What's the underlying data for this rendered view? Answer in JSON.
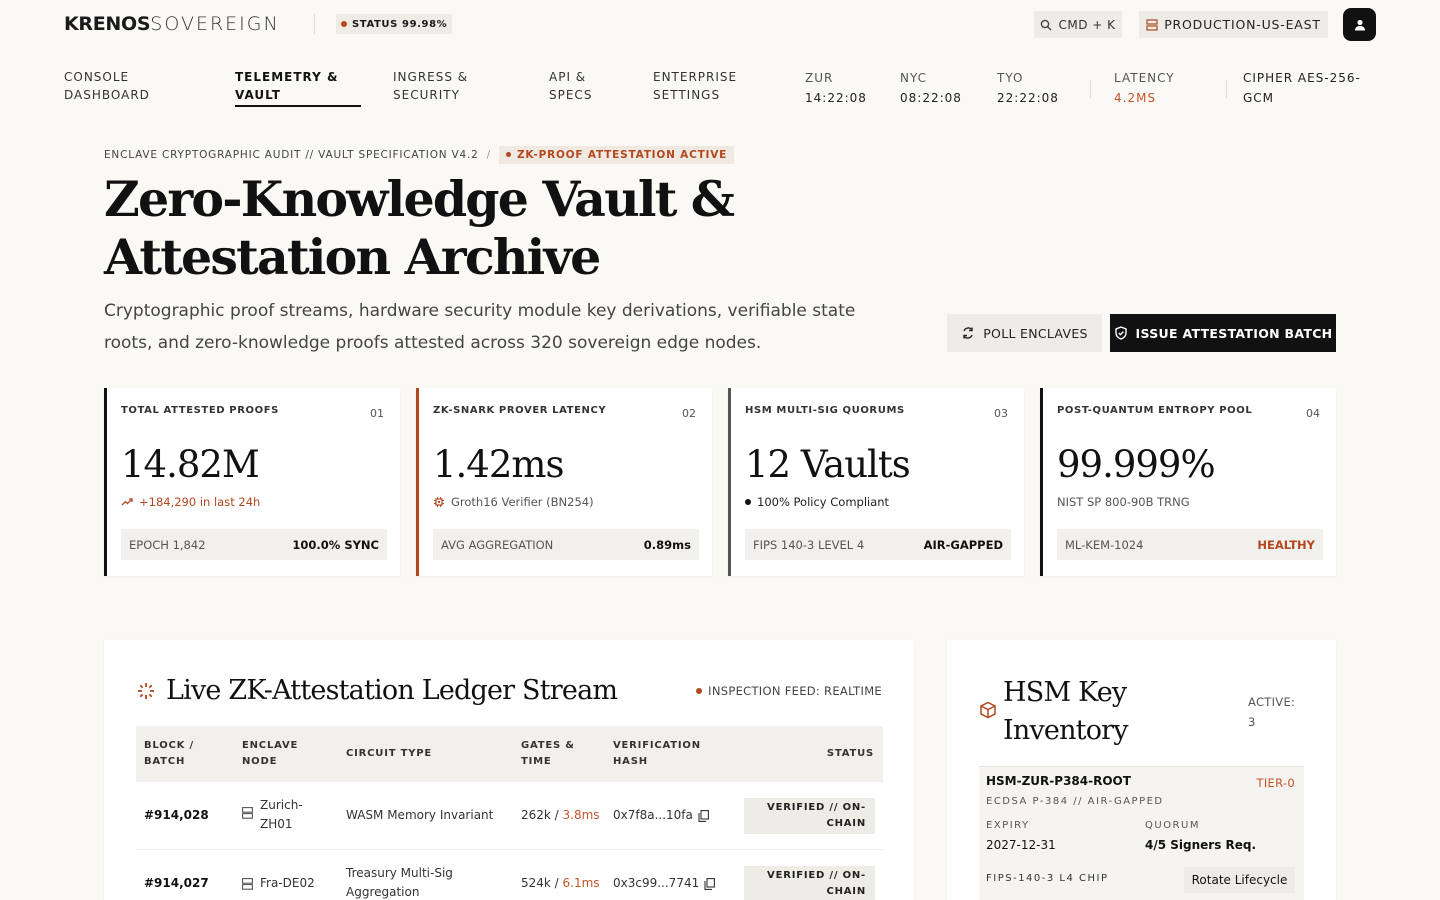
{
  "brand": {
    "bold": "KRENOS",
    "light": "SOVEREIGN"
  },
  "status": {
    "label": "STATUS 99.98%"
  },
  "search": {
    "label": "CMD + K"
  },
  "region": {
    "label": "PRODUCTION-US-EAST"
  },
  "nav": {
    "items": [
      {
        "line1": "CONSOLE",
        "line2": "DASHBOARD"
      },
      {
        "line1": "TELEMETRY &",
        "line2": "VAULT"
      },
      {
        "line1": "INGRESS &",
        "line2": "SECURITY"
      },
      {
        "line1": "API &",
        "line2": "SPECS"
      },
      {
        "line1": "ENTERPRISE",
        "line2": "SETTINGS"
      }
    ],
    "clocks": [
      {
        "label": "ZUR",
        "value": "14:22:08"
      },
      {
        "label": "NYC",
        "value": "08:22:08"
      },
      {
        "label": "TYO",
        "value": "22:22:08"
      }
    ],
    "latency": {
      "label": "LATENCY",
      "value": "4.2MS"
    },
    "cipher": {
      "line1": "CIPHER AES-256-",
      "line2": "GCM"
    }
  },
  "hero": {
    "breadcrumb": "ENCLAVE CRYPTOGRAPHIC AUDIT // VAULT SPECIFICATION V4.2",
    "breadcrumb_sep": "/",
    "badge": "ZK-PROOF ATTESTATION ACTIVE",
    "title_line1": "Zero-Knowledge Vault &",
    "title_line2": "Attestation Archive",
    "subtitle": "Cryptographic proof streams, hardware security module key derivations, verifiable state roots, and zero-knowledge proofs attested across 320 sovereign edge nodes.",
    "poll_button": "POLL ENCLAVES",
    "issue_button": "ISSUE ATTESTATION BATCH"
  },
  "cards": [
    {
      "label": "TOTAL ATTESTED PROOFS",
      "num": "01",
      "value": "14.82M",
      "sub": "+184,290 in last 24h",
      "foot_left": "EPOCH 1,842",
      "foot_right": "100.0% SYNC"
    },
    {
      "label": "ZK-SNARK PROVER LATENCY",
      "num": "02",
      "value": "1.42ms",
      "sub": "Groth16 Verifier (BN254)",
      "foot_left": "AVG AGGREGATION",
      "foot_right": "0.89ms"
    },
    {
      "label": "HSM MULTI-SIG QUORUMS",
      "num": "03",
      "value": "12 Vaults",
      "sub": "100% Policy Compliant",
      "foot_left": "FIPS 140-3 LEVEL 4",
      "foot_right": "AIR-GAPPED"
    },
    {
      "label": "POST-QUANTUM ENTROPY POOL",
      "num": "04",
      "value": "99.999%",
      "sub": "NIST SP 800-90B TRNG",
      "foot_left": "ML-KEM-1024",
      "foot_right": "HEALTHY"
    }
  ],
  "ledger": {
    "title": "Live ZK-Attestation Ledger Stream",
    "feed": "INSPECTION FEED: REALTIME",
    "headers": [
      {
        "l1": "BLOCK /",
        "l2": "BATCH"
      },
      {
        "l1": "ENCLAVE",
        "l2": "NODE"
      },
      {
        "l1": "CIRCUIT TYPE",
        "l2": ""
      },
      {
        "l1": "GATES &",
        "l2": "TIME"
      },
      {
        "l1": "VERIFICATION",
        "l2": "HASH"
      },
      {
        "l1": "STATUS",
        "l2": ""
      }
    ],
    "rows": [
      {
        "block": "#914,028",
        "node1": "Zurich-",
        "node2": "ZH01",
        "circuit1": "WASM Memory Invariant",
        "circuit2": "",
        "gates": "262k / ",
        "time": "3.8ms",
        "hash": "0x7f8a...10fa",
        "status1": "VERIFIED // ON-",
        "status2": "CHAIN"
      },
      {
        "block": "#914,027",
        "node1": "Fra-DE02",
        "node2": "",
        "circuit1": "Treasury Multi-Sig",
        "circuit2": "Aggregation",
        "gates": "524k / ",
        "time": "6.1ms",
        "hash": "0x3c99...7741",
        "status1": "VERIFIED // ON-",
        "status2": "CHAIN"
      }
    ]
  },
  "hsm": {
    "title_line1": "HSM Key",
    "title_line2": "Inventory",
    "active_label": "ACTIVE:",
    "active_count": "3",
    "key": {
      "name": "HSM-ZUR-P384-ROOT",
      "tier": "TIER-0",
      "algo": "ECDSA P-384 // AIR-GAPPED",
      "expiry_label": "EXPIRY",
      "expiry": "2027-12-31",
      "quorum_label": "QUORUM",
      "quorum": "4/5 Signers Req.",
      "chip": "FIPS-140-3 L4 CHIP",
      "rotate": "Rotate Lifecycle"
    }
  },
  "colors": {
    "accent": "#b3471e",
    "ink": "#111111",
    "background": "#faf9f6",
    "panel": "#eeece7"
  }
}
